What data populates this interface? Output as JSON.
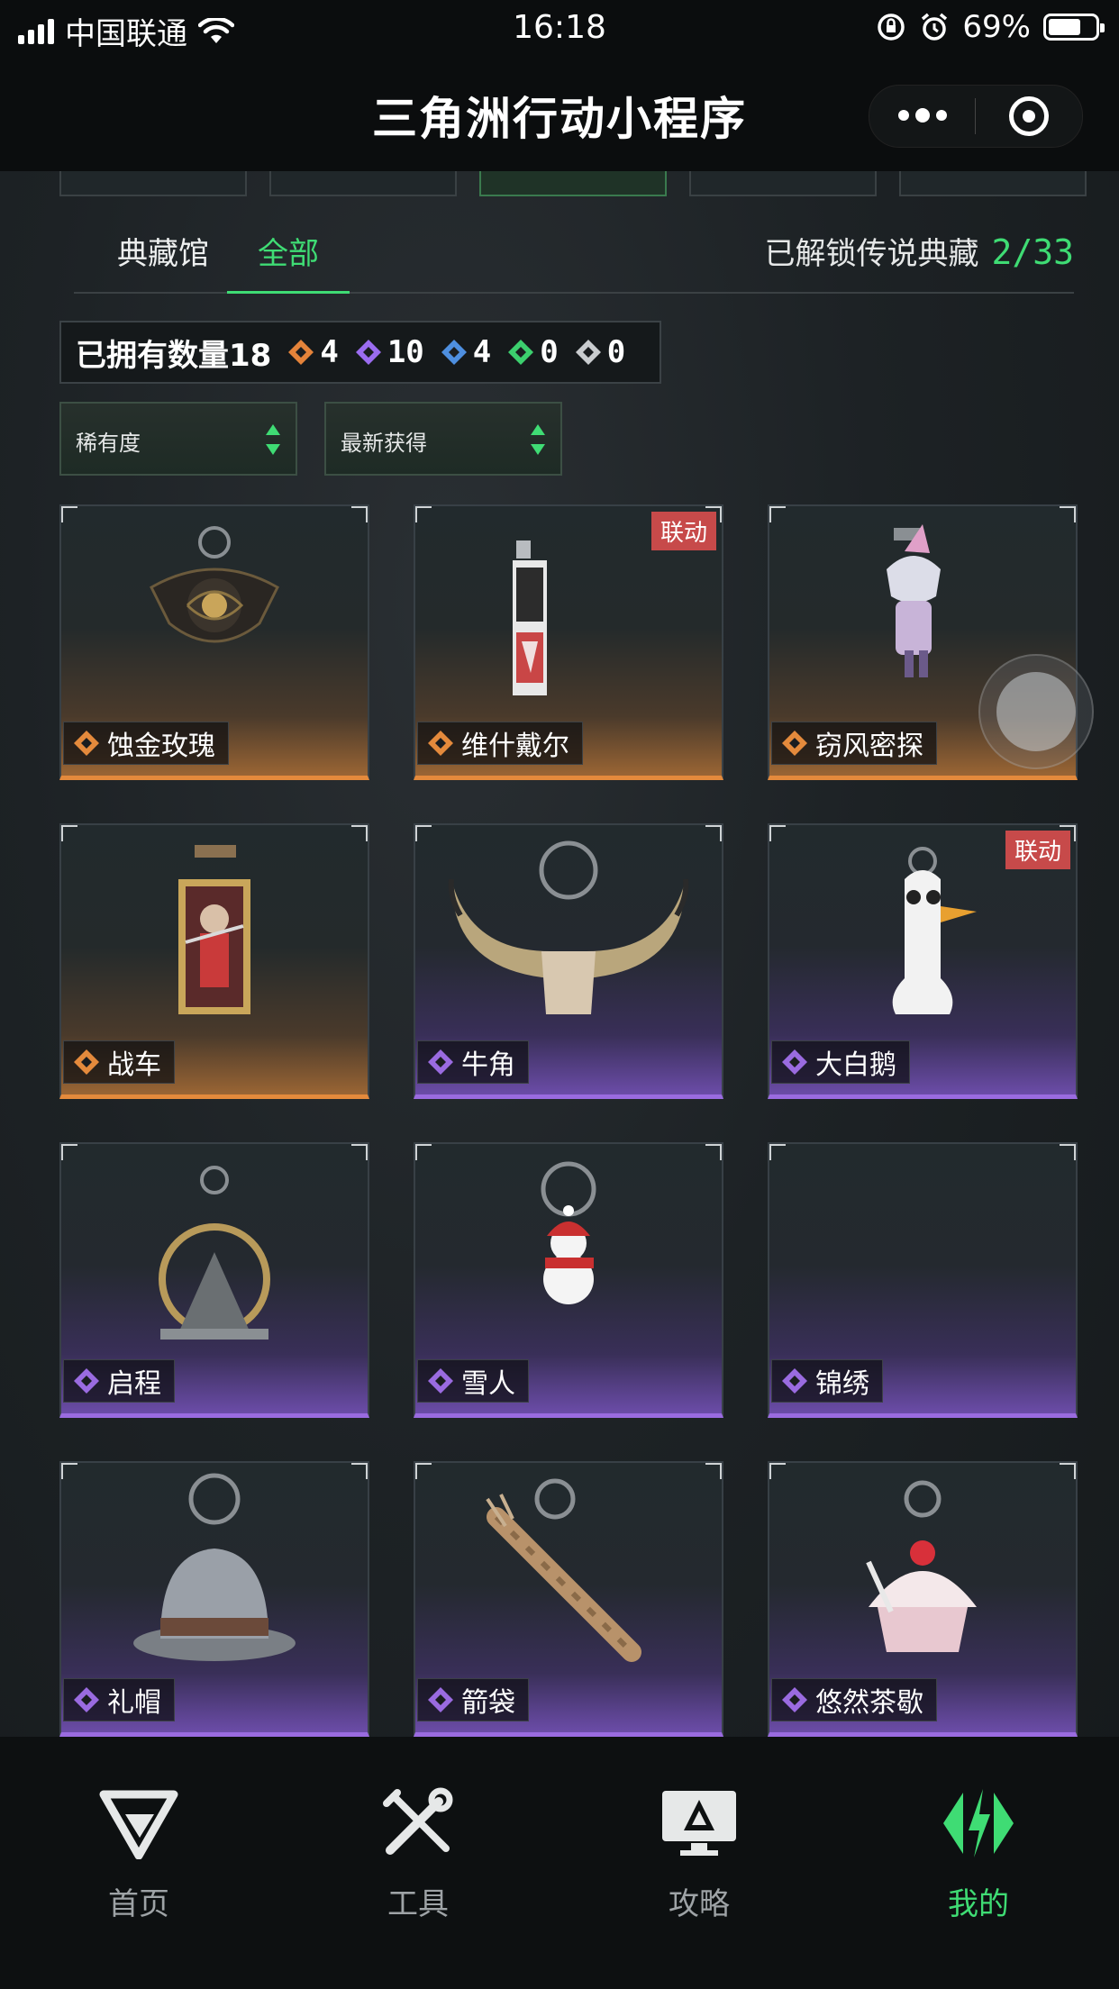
{
  "status_bar": {
    "carrier": "中国联通",
    "time": "16:18",
    "battery_percent": "69%",
    "battery_level": 0.69
  },
  "title_bar": {
    "title": "三角洲行动小程序",
    "more_icon": "more-dots-icon",
    "close_icon": "target-circle-icon"
  },
  "subnav": {
    "tabs": [
      "典藏馆",
      "全部"
    ],
    "active_tab": "全部",
    "unlock_label": "已解锁传说典藏",
    "unlock_value": "2/33"
  },
  "owned": {
    "label": "已拥有数量18",
    "counts": [
      {
        "icon": "legend-diamond-icon",
        "color": "#e4833a",
        "value": "4"
      },
      {
        "icon": "epic-diamond-icon",
        "color": "#9b6cf0",
        "value": "10"
      },
      {
        "icon": "rare-diamond-icon",
        "color": "#4e8fe0",
        "value": "4"
      },
      {
        "icon": "uncommon-diamond-icon",
        "color": "#3ccf6e",
        "value": "0"
      },
      {
        "icon": "common-diamond-icon",
        "color": "#c9cccf",
        "value": "0"
      }
    ]
  },
  "filters": {
    "rarity": "稀有度",
    "sort": "最新获得"
  },
  "items": [
    {
      "name": "蚀金玫瑰",
      "rarity": "legend",
      "badge": ""
    },
    {
      "name": "维什戴尔",
      "rarity": "legend",
      "badge": "联动"
    },
    {
      "name": "窃风密探",
      "rarity": "legend",
      "badge": ""
    },
    {
      "name": "战车",
      "rarity": "legend",
      "badge": ""
    },
    {
      "name": "牛角",
      "rarity": "epic",
      "badge": ""
    },
    {
      "name": "大白鹅",
      "rarity": "epic",
      "badge": "联动"
    },
    {
      "name": "启程",
      "rarity": "epic",
      "badge": ""
    },
    {
      "name": "雪人",
      "rarity": "epic",
      "badge": ""
    },
    {
      "name": "锦绣",
      "rarity": "epic",
      "badge": ""
    },
    {
      "name": "礼帽",
      "rarity": "epic",
      "badge": ""
    },
    {
      "name": "箭袋",
      "rarity": "epic",
      "badge": ""
    },
    {
      "name": "悠然茶歇",
      "rarity": "epic",
      "badge": ""
    }
  ],
  "colors": {
    "accent_green": "#3fdc74",
    "legend_orange": "#e48a3c",
    "epic_purple": "#9a6be0",
    "badge_red": "#c74a4a"
  },
  "bottom_nav": [
    {
      "label": "首页",
      "icon": "home-logo-icon"
    },
    {
      "label": "工具",
      "icon": "tools-icon"
    },
    {
      "label": "攻略",
      "icon": "guide-monitor-icon"
    },
    {
      "label": "我的",
      "icon": "profile-logo-icon",
      "active": true
    }
  ]
}
